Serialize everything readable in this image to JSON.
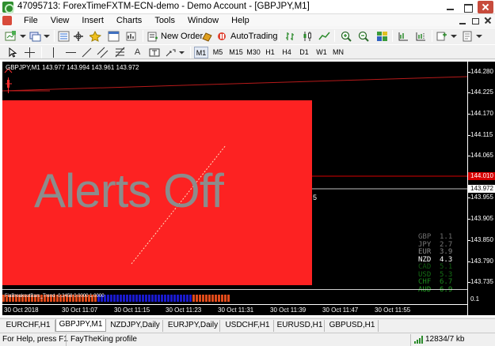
{
  "window": {
    "title": "47095713: ForexTimeFXTM-ECN-demo - Demo Account - [GBPJPY,M1]"
  },
  "menu": {
    "items": [
      "File",
      "View",
      "Insert",
      "Charts",
      "Tools",
      "Window",
      "Help"
    ]
  },
  "toolbar": {
    "new_order_label": "New Order",
    "autotrading_label": "AutoTrading"
  },
  "timeframes": [
    "M1",
    "M5",
    "M15",
    "M30",
    "H1",
    "H4",
    "D1",
    "W1",
    "MN"
  ],
  "chart": {
    "header": "GBPJPY,M1  143.977 143.994 143.961 143.972",
    "overlay_text": "Alerts Off",
    "stray_digit": "5",
    "price_labels": [
      "144.280",
      "144.225",
      "144.170",
      "144.115",
      "144.065",
      "144.010",
      "143.955",
      "143.905",
      "143.850",
      "143.790",
      "143.735"
    ],
    "ask_price": "144.010",
    "bid_price": "143.972",
    "indicator_label": "FiaBreakoutBars_Trend -0.2458 0.0000 1.0000",
    "indicator_axis": "0.1",
    "time_labels": [
      "30 Oct 2018",
      "30 Oct 11:07",
      "30 Oct 11:15",
      "30 Oct 11:23",
      "30 Oct 11:31",
      "30 Oct 11:39",
      "30 Oct 11:47",
      "30 Oct 11:55"
    ],
    "colors": {
      "background": "#000000",
      "alert_box": "#fd2222",
      "alert_text": "#8c8c8c",
      "bid_line": "#c0c0c0",
      "ask_badge": "#d80000"
    }
  },
  "currency_strength": [
    {
      "name": "GBP",
      "value": "1.1",
      "color": "#6f6f6f"
    },
    {
      "name": "JPY",
      "value": "2.7",
      "color": "#7a7a7a"
    },
    {
      "name": "EUR",
      "value": "3.9",
      "color": "#8a8a8a"
    },
    {
      "name": "NZD",
      "value": "4.3",
      "color": "#ffffff"
    },
    {
      "name": "CAD",
      "value": "5.1",
      "color": "#0f5a0f"
    },
    {
      "name": "USD",
      "value": "5.3",
      "color": "#157015"
    },
    {
      "name": "CHF",
      "value": "6.7",
      "color": "#1c8a1c"
    },
    {
      "name": "AUD",
      "value": "6.9",
      "color": "#23a023"
    }
  ],
  "tabs": [
    {
      "label": "EURCHF,H1",
      "active": false
    },
    {
      "label": "GBPJPY,M1",
      "active": true
    },
    {
      "label": "NZDJPY,Daily",
      "active": false
    },
    {
      "label": "EURJPY,Daily",
      "active": false
    },
    {
      "label": "USDCHF,H1",
      "active": false
    },
    {
      "label": "EURUSD,H1",
      "active": false
    },
    {
      "label": "GBPUSD,H1",
      "active": false
    }
  ],
  "status": {
    "help_text": "For Help, press F1",
    "profile": "FayTheKing profile",
    "traffic": "12834/7 kb"
  }
}
